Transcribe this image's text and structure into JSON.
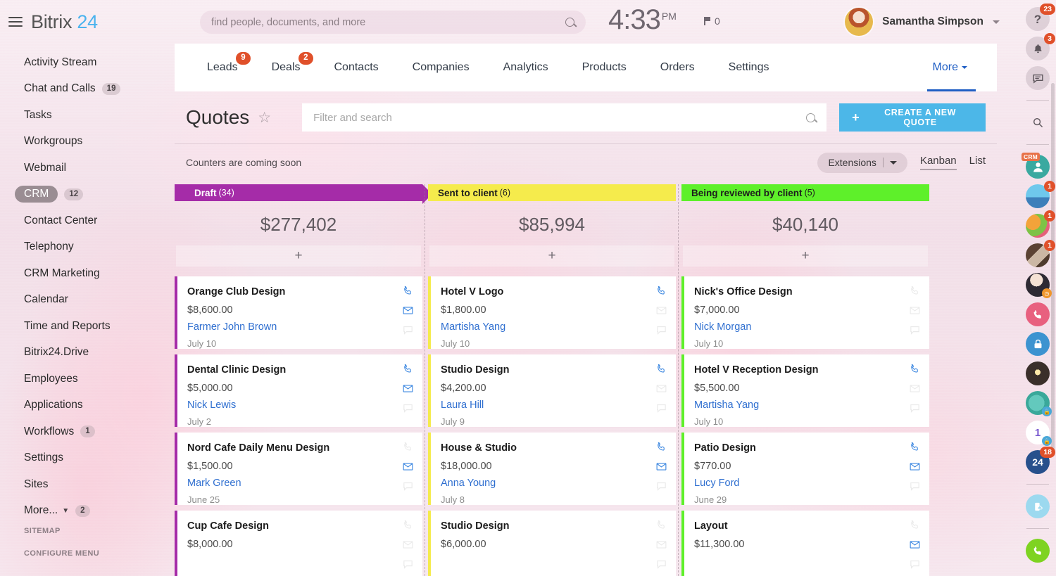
{
  "brand": {
    "name": "Bitrix",
    "number": "24"
  },
  "topbar": {
    "search_placeholder": "find people, documents, and more",
    "time": "4:33",
    "ampm": "PM",
    "flag_count": "0",
    "user_name": "Samantha Simpson"
  },
  "sidebar": {
    "items": [
      {
        "label": "Activity Stream",
        "badge": ""
      },
      {
        "label": "Chat and Calls",
        "badge": "19"
      },
      {
        "label": "Tasks",
        "badge": ""
      },
      {
        "label": "Workgroups",
        "badge": ""
      },
      {
        "label": "Webmail",
        "badge": ""
      },
      {
        "label": "CRM",
        "badge": "12",
        "active": true
      },
      {
        "label": "Contact Center",
        "badge": ""
      },
      {
        "label": "Telephony",
        "badge": ""
      },
      {
        "label": "CRM Marketing",
        "badge": ""
      },
      {
        "label": "Calendar",
        "badge": ""
      },
      {
        "label": "Time and Reports",
        "badge": ""
      },
      {
        "label": "Bitrix24.Drive",
        "badge": ""
      },
      {
        "label": "Employees",
        "badge": ""
      },
      {
        "label": "Applications",
        "badge": ""
      },
      {
        "label": "Workflows",
        "badge": "1"
      },
      {
        "label": "Settings",
        "badge": ""
      },
      {
        "label": "Sites",
        "badge": ""
      },
      {
        "label": "More...",
        "badge": "2",
        "caret": true
      }
    ],
    "sitemap_label": "SITEMAP",
    "configure_label": "CONFIGURE MENU"
  },
  "crm_tabs": [
    {
      "label": "Leads",
      "badge": "9"
    },
    {
      "label": "Deals",
      "badge": "2"
    },
    {
      "label": "Contacts",
      "badge": ""
    },
    {
      "label": "Companies",
      "badge": ""
    },
    {
      "label": "Analytics",
      "badge": ""
    },
    {
      "label": "Products",
      "badge": ""
    },
    {
      "label": "Orders",
      "badge": ""
    },
    {
      "label": "Settings",
      "badge": ""
    }
  ],
  "crm_more_label": "More",
  "page": {
    "title": "Quotes",
    "filter_placeholder": "Filter and search",
    "create_button": "CREATE A NEW QUOTE",
    "counters_note": "Counters are coming soon",
    "extensions_label": "Extensions",
    "view_kanban": "Kanban",
    "view_list": "List"
  },
  "kanban": {
    "columns": [
      {
        "name": "Draft",
        "count": "(34)",
        "total": "$277,402",
        "color": "#a52ca8",
        "text_color": "#ffffff",
        "add_label": "+",
        "cards": [
          {
            "title": "Orange Club Design",
            "amount": "$8,600.00",
            "person": "Farmer John Brown",
            "date": "July 10",
            "phone_on": true,
            "mail_on": true,
            "chat_on": false
          },
          {
            "title": "Dental Clinic Design",
            "amount": "$5,000.00",
            "person": "Nick Lewis",
            "date": "July 2",
            "phone_on": true,
            "mail_on": true,
            "chat_on": false
          },
          {
            "title": "Nord Cafe Daily Menu Design",
            "amount": "$1,500.00",
            "person": "Mark Green",
            "date": "June 25",
            "phone_on": false,
            "mail_on": true,
            "chat_on": false
          },
          {
            "title": "Cup Cafe Design",
            "amount": "$8,000.00",
            "person": "",
            "date": "",
            "phone_on": false,
            "mail_on": false,
            "chat_on": false
          }
        ]
      },
      {
        "name": "Sent to client",
        "count": "(6)",
        "total": "$85,994",
        "color": "#f5eb4c",
        "text_color": "#1d1d1d",
        "add_label": "+",
        "cards": [
          {
            "title": "Hotel V Logo",
            "amount": "$1,800.00",
            "person": "Martisha Yang",
            "date": "July 10",
            "phone_on": true,
            "mail_on": false,
            "chat_on": false
          },
          {
            "title": "Studio Design",
            "amount": "$4,200.00",
            "person": "Laura Hill",
            "date": "July 9",
            "phone_on": true,
            "mail_on": false,
            "chat_on": false
          },
          {
            "title": "House & Studio",
            "amount": "$18,000.00",
            "person": "Anna Young",
            "date": "July 8",
            "phone_on": true,
            "mail_on": true,
            "chat_on": false
          },
          {
            "title": "Studio Design",
            "amount": "$6,000.00",
            "person": "",
            "date": "",
            "phone_on": false,
            "mail_on": false,
            "chat_on": false
          }
        ]
      },
      {
        "name": "Being reviewed by client",
        "count": "(5)",
        "total": "$40,140",
        "color": "#5ef02a",
        "text_color": "#1d1d1d",
        "add_label": "+",
        "cards": [
          {
            "title": "Nick's Office Design",
            "amount": "$7,000.00",
            "person": "Nick Morgan",
            "date": "July 10",
            "phone_on": false,
            "mail_on": false,
            "chat_on": false
          },
          {
            "title": "Hotel V Reception Design",
            "amount": "$5,500.00",
            "person": "Martisha Yang",
            "date": "July 10",
            "phone_on": true,
            "mail_on": false,
            "chat_on": false
          },
          {
            "title": "Patio Design",
            "amount": "$770.00",
            "person": "Lucy Ford",
            "date": "June 29",
            "phone_on": true,
            "mail_on": true,
            "chat_on": false
          },
          {
            "title": "Layout",
            "amount": "$11,300.00",
            "person": "",
            "date": "",
            "phone_on": false,
            "mail_on": true,
            "chat_on": false
          }
        ]
      }
    ]
  },
  "right_rail": {
    "help_badge": "23",
    "notifications_badge": "3",
    "crm_tag": "CRM",
    "avatar_badges": [
      "1",
      "1",
      "1"
    ],
    "b24_label": "24",
    "b24_badge": "18"
  }
}
